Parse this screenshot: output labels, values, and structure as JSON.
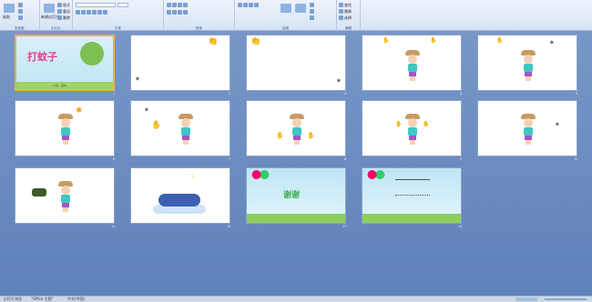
{
  "ribbon": {
    "groups": [
      {
        "label": "剪贴板"
      },
      {
        "label": "幻灯片"
      },
      {
        "label": "字体"
      },
      {
        "label": "段落"
      },
      {
        "label": "绘图"
      },
      {
        "label": "编辑"
      }
    ],
    "paste_label": "粘贴",
    "new_slide_label": "新建幻灯片",
    "layout_label": "版式",
    "reset_label": "重设",
    "delete_label": "删除",
    "find_label": "查找",
    "replace_label": "替换",
    "select_label": "选择"
  },
  "slides": [
    {
      "num": "1",
      "title": "打蚊子",
      "subtitle": "小班 · 语言"
    },
    {
      "num": "2"
    },
    {
      "num": "3"
    },
    {
      "num": "4"
    },
    {
      "num": "5"
    },
    {
      "num": "6"
    },
    {
      "num": "7"
    },
    {
      "num": "8"
    },
    {
      "num": "9"
    },
    {
      "num": "10"
    },
    {
      "num": "11"
    },
    {
      "num": "12"
    },
    {
      "num": "13",
      "title": "谢谢"
    },
    {
      "num": "14"
    }
  ],
  "status": {
    "left": "幻灯片浏览",
    "theme": "\"Office 主题\"",
    "lang": "中文(中国)"
  }
}
